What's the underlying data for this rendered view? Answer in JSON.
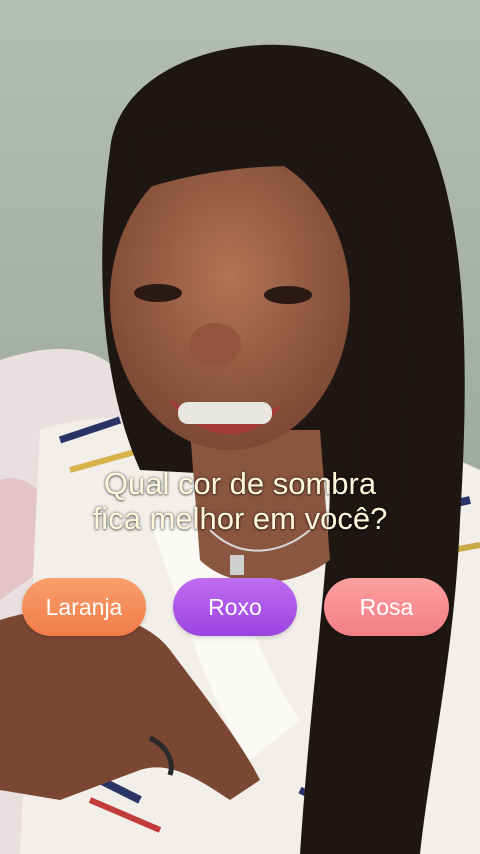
{
  "quiz": {
    "question_line1": "Qual cor de sombra",
    "question_line2": "fica melhor em você?",
    "options": [
      {
        "label": "Laranja",
        "color": "#f38a55"
      },
      {
        "label": "Roxo",
        "color": "#a955e6"
      },
      {
        "label": "Rosa",
        "color": "#f68c91"
      }
    ]
  }
}
